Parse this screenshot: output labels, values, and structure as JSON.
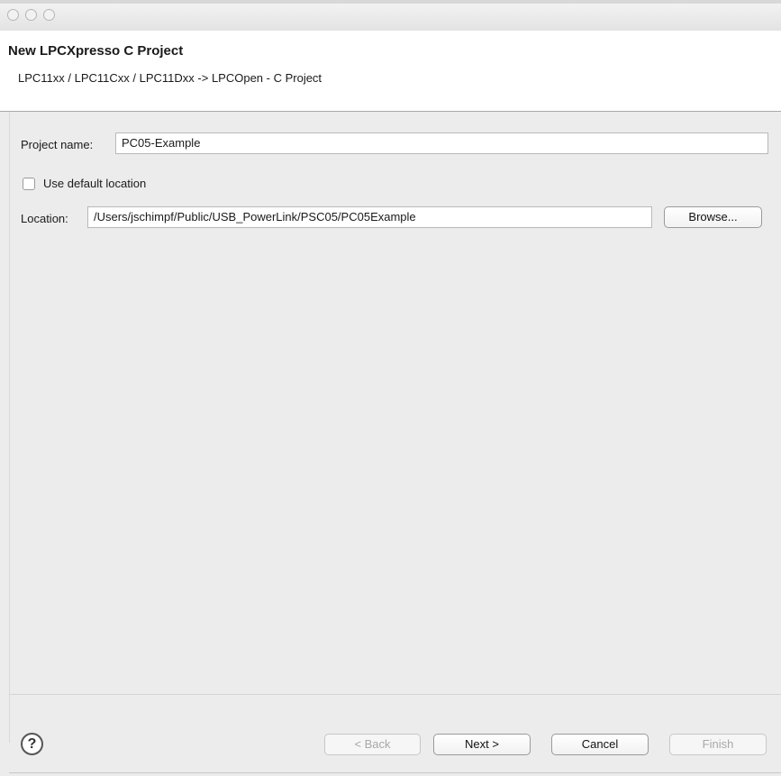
{
  "window": {
    "traffic_lights": [
      "close-icon",
      "minimize-icon",
      "zoom-icon"
    ]
  },
  "header": {
    "title": "New LPCXpresso C Project",
    "subtitle": "LPC11xx / LPC11Cxx / LPC11Dxx -> LPCOpen - C Project"
  },
  "form": {
    "project_name_label": "Project name:",
    "project_name_value": "PC05-Example",
    "use_default_location_label": "Use default location",
    "use_default_location_checked": false,
    "location_label": "Location:",
    "location_value": "/Users/jschimpf/Public/USB_PowerLink/PSC05/PC05Example",
    "browse_label": "Browse..."
  },
  "footer": {
    "help_icon": "help-icon",
    "help_glyph": "?",
    "back_label": "< Back",
    "next_label": "Next >",
    "cancel_label": "Cancel",
    "finish_label": "Finish"
  }
}
